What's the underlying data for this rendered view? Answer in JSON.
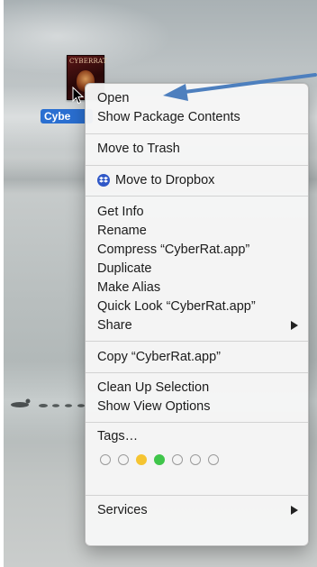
{
  "desktop": {
    "file": {
      "icon_text": "CYBERRAT",
      "label": "Cybe"
    }
  },
  "context_menu": {
    "open": "Open",
    "show_package_contents": "Show Package Contents",
    "move_to_trash": "Move to Trash",
    "move_to_dropbox": "Move to Dropbox",
    "get_info": "Get Info",
    "rename": "Rename",
    "compress": "Compress “CyberRat.app”",
    "duplicate": "Duplicate",
    "make_alias": "Make Alias",
    "quick_look": "Quick Look “CyberRat.app”",
    "share": "Share",
    "copy": "Copy “CyberRat.app”",
    "clean_up_selection": "Clean Up Selection",
    "show_view_options": "Show View Options",
    "tags_label": "Tags…",
    "tag_colors": [
      "none",
      "none",
      "#f5c431",
      "#3fc54a",
      "none",
      "none",
      "none"
    ],
    "services": "Services"
  },
  "colors": {
    "selection_blue": "#2a6fd1",
    "annotation_arrow": "#4d7fbe",
    "dropbox_blue": "#2f57c7"
  }
}
